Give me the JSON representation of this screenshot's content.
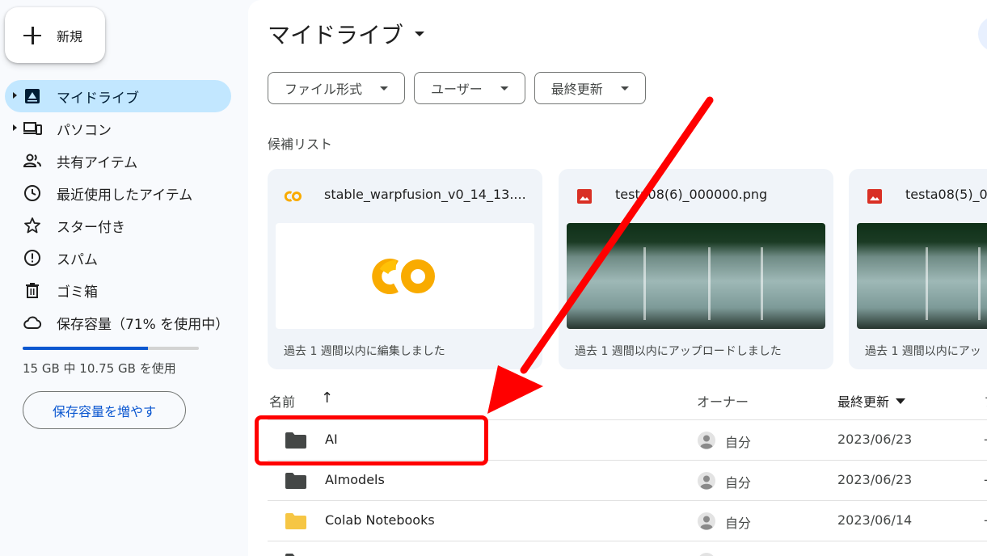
{
  "new_button": {
    "label": "新規",
    "icon": "plus-icon"
  },
  "nav": {
    "items": [
      {
        "label": "マイドライブ",
        "icon": "my-drive-icon",
        "active": true,
        "expandable": true
      },
      {
        "label": "パソコン",
        "icon": "computers-icon",
        "active": false,
        "expandable": true
      },
      {
        "label": "共有アイテム",
        "icon": "shared-people-icon",
        "active": false
      },
      {
        "label": "最近使用したアイテム",
        "icon": "clock-icon",
        "active": false
      },
      {
        "label": "スター付き",
        "icon": "star-icon",
        "active": false
      },
      {
        "label": "スパム",
        "icon": "spam-icon",
        "active": false
      },
      {
        "label": "ゴミ箱",
        "icon": "trash-icon",
        "active": false
      },
      {
        "label": "保存容量（71% を使用中）",
        "icon": "cloud-icon",
        "active": false
      }
    ]
  },
  "storage": {
    "used_fraction": 0.71,
    "text": "15 GB 中 10.75 GB を使用",
    "upgrade_label": "保存容量を増やす"
  },
  "main": {
    "title": "マイドライブ",
    "filters": [
      "ファイル形式",
      "ユーザー",
      "最終更新"
    ],
    "suggested_label": "候補リスト",
    "cards": [
      {
        "name": "stable_warpfusion_v0_14_13....",
        "icon": "colab-icon",
        "meta": "過去 1 週間以内に編集しました"
      },
      {
        "name": "testa08(6)_000000.png",
        "icon": "image-file-icon",
        "meta": "過去 1 週間以内にアップロードしました"
      },
      {
        "name": "testa08(5)_0",
        "icon": "image-file-icon",
        "meta": "過去 1 週間以内にアッ"
      }
    ],
    "columns": {
      "name": "名前",
      "owner": "オーナー",
      "modified": "最終更新",
      "edge": "フ"
    },
    "rows": [
      {
        "name": "AI",
        "folder_type": "regular",
        "owner": "自分",
        "date": "2023/06/23",
        "edge": "-"
      },
      {
        "name": "AImodels",
        "folder_type": "regular",
        "owner": "自分",
        "date": "2023/06/23",
        "edge": "-"
      },
      {
        "name": "Colab Notebooks",
        "folder_type": "colab",
        "owner": "自分",
        "date": "2023/06/14",
        "edge": "-"
      },
      {
        "name": "",
        "folder_type": "regular",
        "owner": "",
        "date": "",
        "edge": ""
      }
    ]
  },
  "colors": {
    "accent": "#0b57d0",
    "active_nav_bg": "#c2e7ff",
    "annotation": "#ff0000",
    "colab_yellow": "#f9ab00",
    "image_icon_red": "#d93025"
  }
}
